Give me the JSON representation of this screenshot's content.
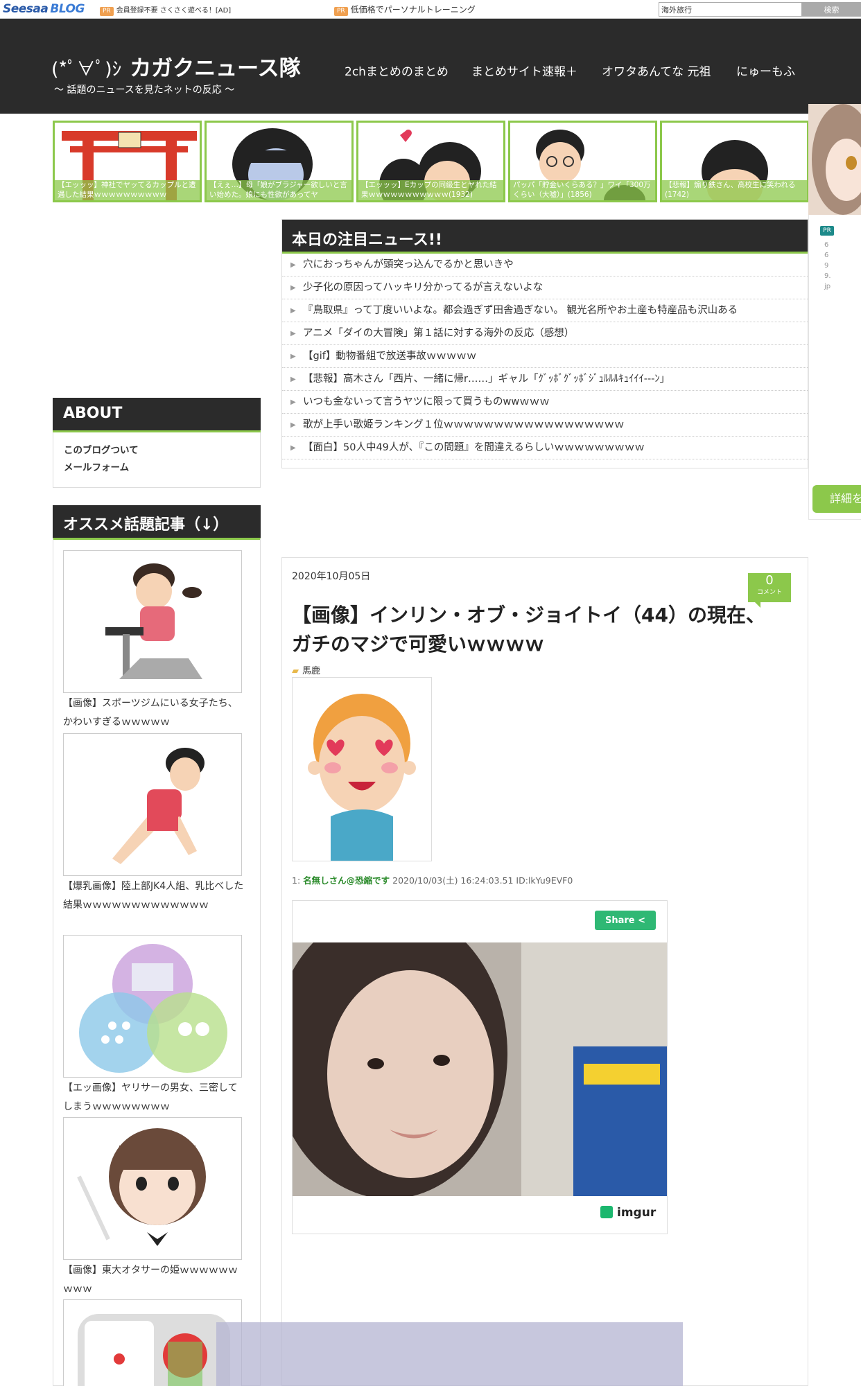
{
  "topbar": {
    "logo_main": "Seesaa",
    "logo_sub": "BLOG",
    "pr_label": "PR",
    "ad1": "会員登録不要 さくさく遊べる！[AD]",
    "ad2": "低価格でパーソナルトレーニング",
    "search_value": "海外旅行",
    "search_button": "検索"
  },
  "header": {
    "face": "(*ﾟ∀ﾟ)ｼ",
    "title": "カガクニュース隊",
    "subtitle": "～ 話題のニュースを見たネットの反応 ～",
    "nav": [
      "2chまとめのまとめ",
      "まとめサイト速報＋",
      "オワタあんてな 元祖",
      "にゅーもふ"
    ]
  },
  "featured": [
    {
      "caption": "【エッッッ】神社でヤッてるカップルと遭遇した結果ｗｗｗｗｗｗｗｗｗｗ"
    },
    {
      "caption": "【えぇ…】母「娘がブラジャー欲しいと言い始めた。娘にも性欲があってヤ"
    },
    {
      "caption": "【エッッッ】Eカップの同級生とヤれた結果ｗｗｗｗｗｗｗｗｗｗｗ(1932)"
    },
    {
      "caption": "パッパ「貯金いくらある？」ワイ「300万くらい（大嘘）」(1856)"
    },
    {
      "caption": "【悲報】煽り鉄さん、高校生に笑われる(1742)"
    }
  ],
  "right_side": {
    "pr_label": "PR",
    "pr_text": "6699.jp",
    "detail_tab": "詳細を"
  },
  "today_news": {
    "header": "本日の注目ニュース!!",
    "items": [
      "穴におっちゃんが頭突っ込んでるかと思いきや",
      "少子化の原因ってハッキリ分かってるが言えないよな",
      "『鳥取県』って丁度いいよな。都会過ぎず田舎過ぎない。 観光名所やお土産も特産品も沢山ある",
      "アニメ「ダイの大冒険」第１話に対する海外の反応（感想）",
      "【gif】動物番組で放送事故ｗｗｗｗｗ",
      "【悲報】高木さん「西片、一緒に帰r……」ギャル「ｸﾞｯﾎﾞｸﾞｯﾎﾞｼﾞｭﾙﾙﾙｷｭｲｲｲ---ﾝ」",
      "いつも金ないって言うヤツに限って買うものwwｗｗｗ",
      "歌が上手い歌姫ランキング１位ｗｗｗｗｗｗｗｗｗｗｗｗｗｗｗｗｗｗ",
      "【面白】50人中49人が、『この問題』を間違えるらしいｗｗｗｗｗｗｗｗｗ"
    ]
  },
  "sidebar": {
    "about_header": "ABOUT",
    "about_links": [
      "このブログついて",
      "メールフォーム"
    ],
    "rec_header": "オススメ話題記事（↓）",
    "rec_items": [
      {
        "title": "【画像】スポーツジムにいる女子たち、かわいすぎるｗｗｗｗｗ"
      },
      {
        "title": "【爆乳画像】陸上部JK4人組、乳比べした結果ｗｗｗｗｗｗｗｗｗｗｗｗｗ"
      },
      {
        "title": "【エッ画像】ヤリサーの男女、三密してしまうｗｗｗｗｗｗｗｗ"
      },
      {
        "title": "【画像】東大オタサーの姫ｗｗｗｗｗｗｗｗｗ"
      }
    ]
  },
  "article": {
    "date": "2020年10月05日",
    "comment_count": "0",
    "comment_label": "コメント",
    "title": "【画像】インリン・オブ・ジョイトイ（44）の現在、ガチのマジで可愛いｗｗｗｗ",
    "category": "馬鹿",
    "post_number": "1:",
    "post_name": "名無しさん@恐縮です",
    "post_info": "2020/10/03(土) 16:24:03.51 ID:lkYu9EVF0",
    "share_label": "Share",
    "imgur_label": "imgur"
  },
  "colors": {
    "accent_green": "#8cc84b",
    "dark": "#2b2b2b",
    "share_green": "#2fb874"
  }
}
